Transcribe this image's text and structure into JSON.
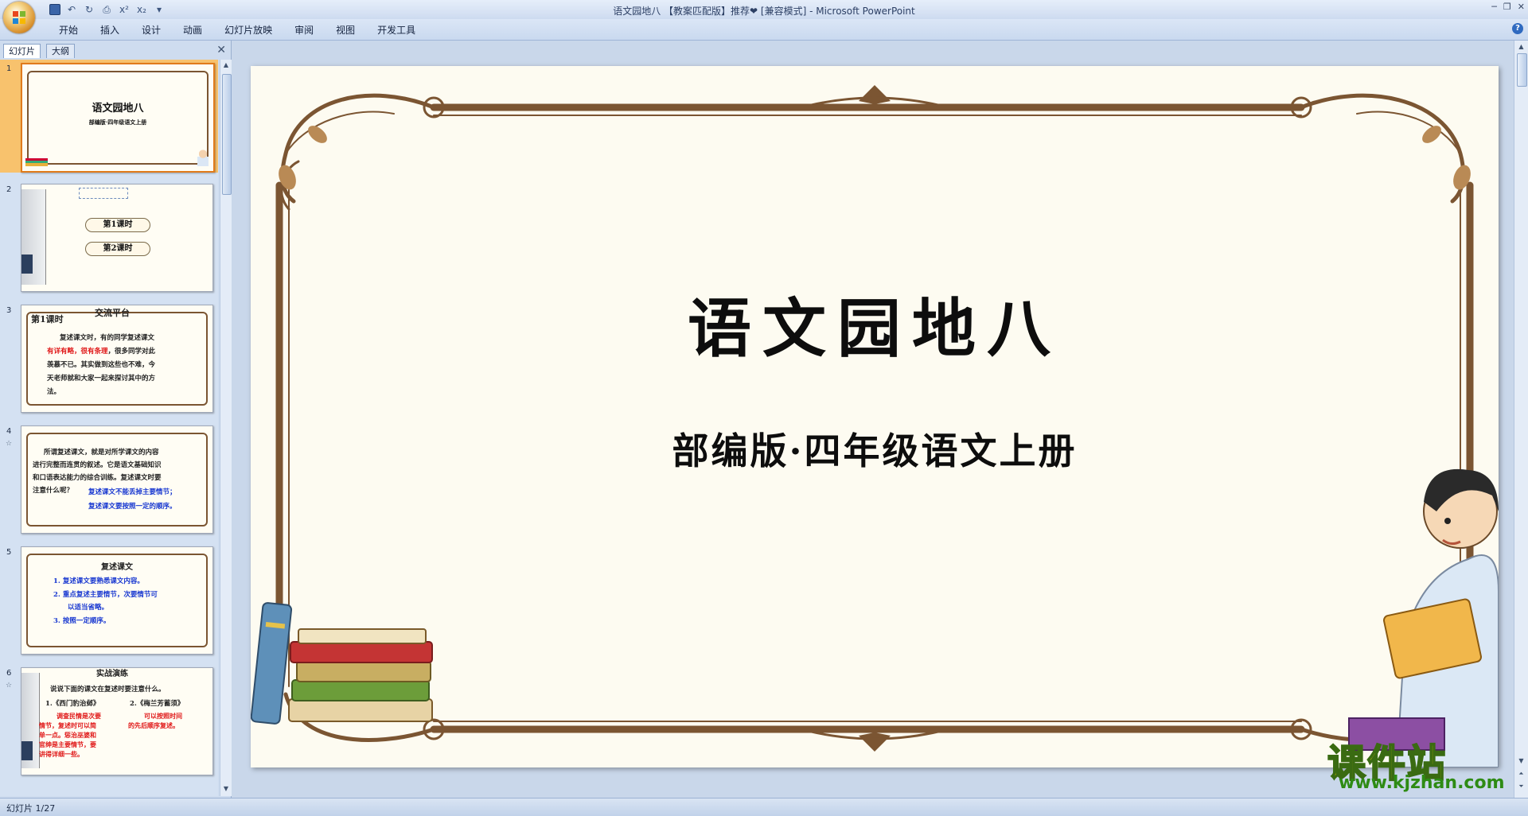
{
  "window": {
    "title": "语文园地八 【教案匹配版】推荐❤ [兼容模式] - Microsoft PowerPoint"
  },
  "qat": {
    "superscript": "x²",
    "subscript": "x₂"
  },
  "ribbon": {
    "tabs": [
      "开始",
      "插入",
      "设计",
      "动画",
      "幻灯片放映",
      "审阅",
      "视图",
      "开发工具"
    ]
  },
  "panel": {
    "tabs": [
      "幻灯片",
      "大纲"
    ]
  },
  "thumbnails": [
    {
      "num": "1",
      "title": "语文园地八",
      "subtitle": "部编版·四年级语文上册"
    },
    {
      "num": "2",
      "items": [
        "第1课时",
        "第2课时"
      ]
    },
    {
      "num": "3",
      "lesson": "第1课时",
      "header": "交流平台",
      "p1": "复述课文时，有的同学复述课文",
      "p2_red": "有详有略，很有条理",
      "p2": "，很多同学对此",
      "p3": "羡慕不已。其实做到这些也不难，今",
      "p4": "天老师就和大家一起来探讨其中的方",
      "p5": "法。"
    },
    {
      "num": "4",
      "l1": "所谓复述课文，就是对所学课文的内容",
      "l2": "进行完整而连贯的叙述。它是语文基础知识",
      "l3": "和口语表达能力的综合训练。复述课文时要",
      "l4": "注意什么呢？",
      "b1": "复述课文不能丢掉主要情节；",
      "b2": "复述课文要按照一定的顺序。"
    },
    {
      "num": "5",
      "heading": "复述课文",
      "i1": "1.  复述课文要熟悉课文内容。",
      "i2": "2.  重点复述主要情节，次要情节可",
      "i2b": "以适当省略。",
      "i3": "3.  按照一定顺序。"
    },
    {
      "num": "6",
      "header": "实战演练",
      "q": "说说下面的课文在复述时要注意什么。",
      "c1": "1.《西门豹治邺》",
      "c2": "2.《梅兰芳蓄须》",
      "r1": "调查民情是次要",
      "r2": "情节，复述时可以简",
      "r3": "单一点。惩治巫婆和",
      "r4": "官绅是主要情节，要",
      "r5": "讲得详细一些。",
      "s1": "可以按照时间",
      "s2": "的先后顺序复述。"
    }
  ],
  "slide": {
    "title": "语文园地八",
    "subtitle": "部编版·四年级语文上册"
  },
  "status": {
    "text": "幻灯片 1/27"
  },
  "watermark": {
    "name": "课件站",
    "url": "www.kjzhan.com"
  },
  "colors": {
    "frame": "#7b5532",
    "accent_red": "#e01818",
    "accent_blue": "#1636d0",
    "selected": "#f8c26d"
  }
}
